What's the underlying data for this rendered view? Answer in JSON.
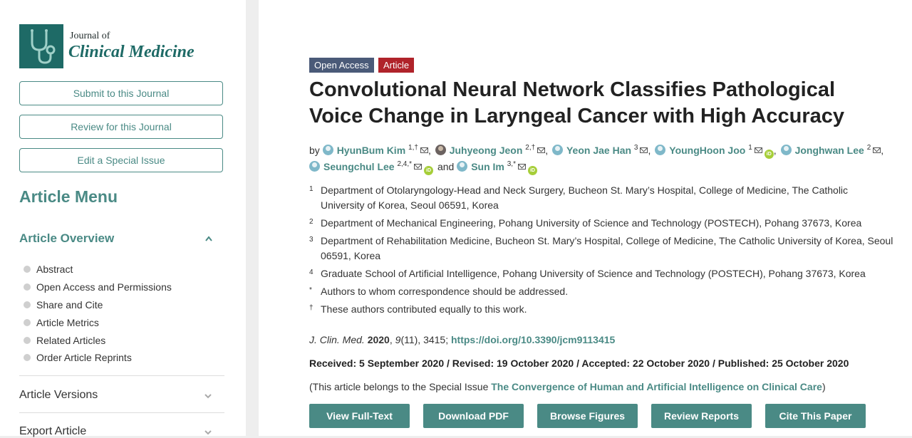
{
  "journal": {
    "small": "Journal of",
    "big": "Clinical Medicine"
  },
  "sidebar": {
    "buttons": [
      "Submit to this Journal",
      "Review for this Journal",
      "Edit a Special Issue"
    ],
    "menu_title": "Article Menu",
    "overview": {
      "label": "Article Overview",
      "items": [
        "Abstract",
        "Open Access and Permissions",
        "Share and Cite",
        "Article Metrics",
        "Related Articles",
        "Order Article Reprints"
      ]
    },
    "versions": "Article Versions",
    "export": "Export Article"
  },
  "article": {
    "badges": {
      "open_access": "Open Access",
      "type": "Article"
    },
    "title": "Convolutional Neural Network Classifies Pathological Voice Change in Laryngeal Cancer with High Accuracy",
    "by": "by",
    "and": "and",
    "authors": [
      {
        "name": "HyunBum Kim",
        "sup": "1,†",
        "sep": ","
      },
      {
        "name": "Juhyeong Jeon",
        "sup": "2,†",
        "sep": ","
      },
      {
        "name": "Yeon Jae Han",
        "sup": "3",
        "sep": ","
      },
      {
        "name": "YoungHoon Joo",
        "sup": "1",
        "sep": ","
      },
      {
        "name": "Jonghwan Lee",
        "sup": "2",
        "sep": ","
      },
      {
        "name": "Seungchul Lee",
        "sup": "2,4,*",
        "sep": ""
      },
      {
        "name": "Sun Im",
        "sup": "3,*",
        "sep": ""
      }
    ],
    "affiliations": [
      {
        "num": "1",
        "text": "Department of Otolaryngology-Head and Neck Surgery, Bucheon St. Mary’s Hospital, College of Medicine, The Catholic University of Korea, Seoul 06591, Korea"
      },
      {
        "num": "2",
        "text": "Department of Mechanical Engineering, Pohang University of Science and Technology (POSTECH), Pohang 37673, Korea"
      },
      {
        "num": "3",
        "text": "Department of Rehabilitation Medicine, Bucheon St. Mary’s Hospital, College of Medicine, The Catholic University of Korea, Seoul 06591, Korea"
      },
      {
        "num": "4",
        "text": "Graduate School of Artificial Intelligence, Pohang University of Science and Technology (POSTECH), Pohang 37673, Korea"
      },
      {
        "num": "*",
        "text": "Authors to whom correspondence should be addressed."
      },
      {
        "num": "†",
        "text": "These authors contributed equally to this work."
      }
    ],
    "citation": {
      "journal": "J. Clin. Med.",
      "year": "2020",
      "volume": "9",
      "issue_pages": "(11), 3415; ",
      "doi": "https://doi.org/10.3390/jcm9113415"
    },
    "dates": "Received: 5 September 2020 / Revised: 19 October 2020 / Accepted: 22 October 2020 / Published: 25 October 2020",
    "special_issue": {
      "prefix": "(This article belongs to the Special Issue ",
      "name": "The Convergence of Human and Artificial Intelligence on Clinical Care",
      "suffix": ")"
    },
    "actions": [
      "View Full-Text",
      "Download PDF",
      "Browse Figures",
      "Review Reports",
      "Cite This Paper"
    ]
  },
  "colors": {
    "accent": "#4a8a85",
    "logo": "#1e6a66",
    "open_access_badge": "#4a5a78",
    "article_badge": "#b0232a",
    "orcid": "#a6ce39"
  }
}
